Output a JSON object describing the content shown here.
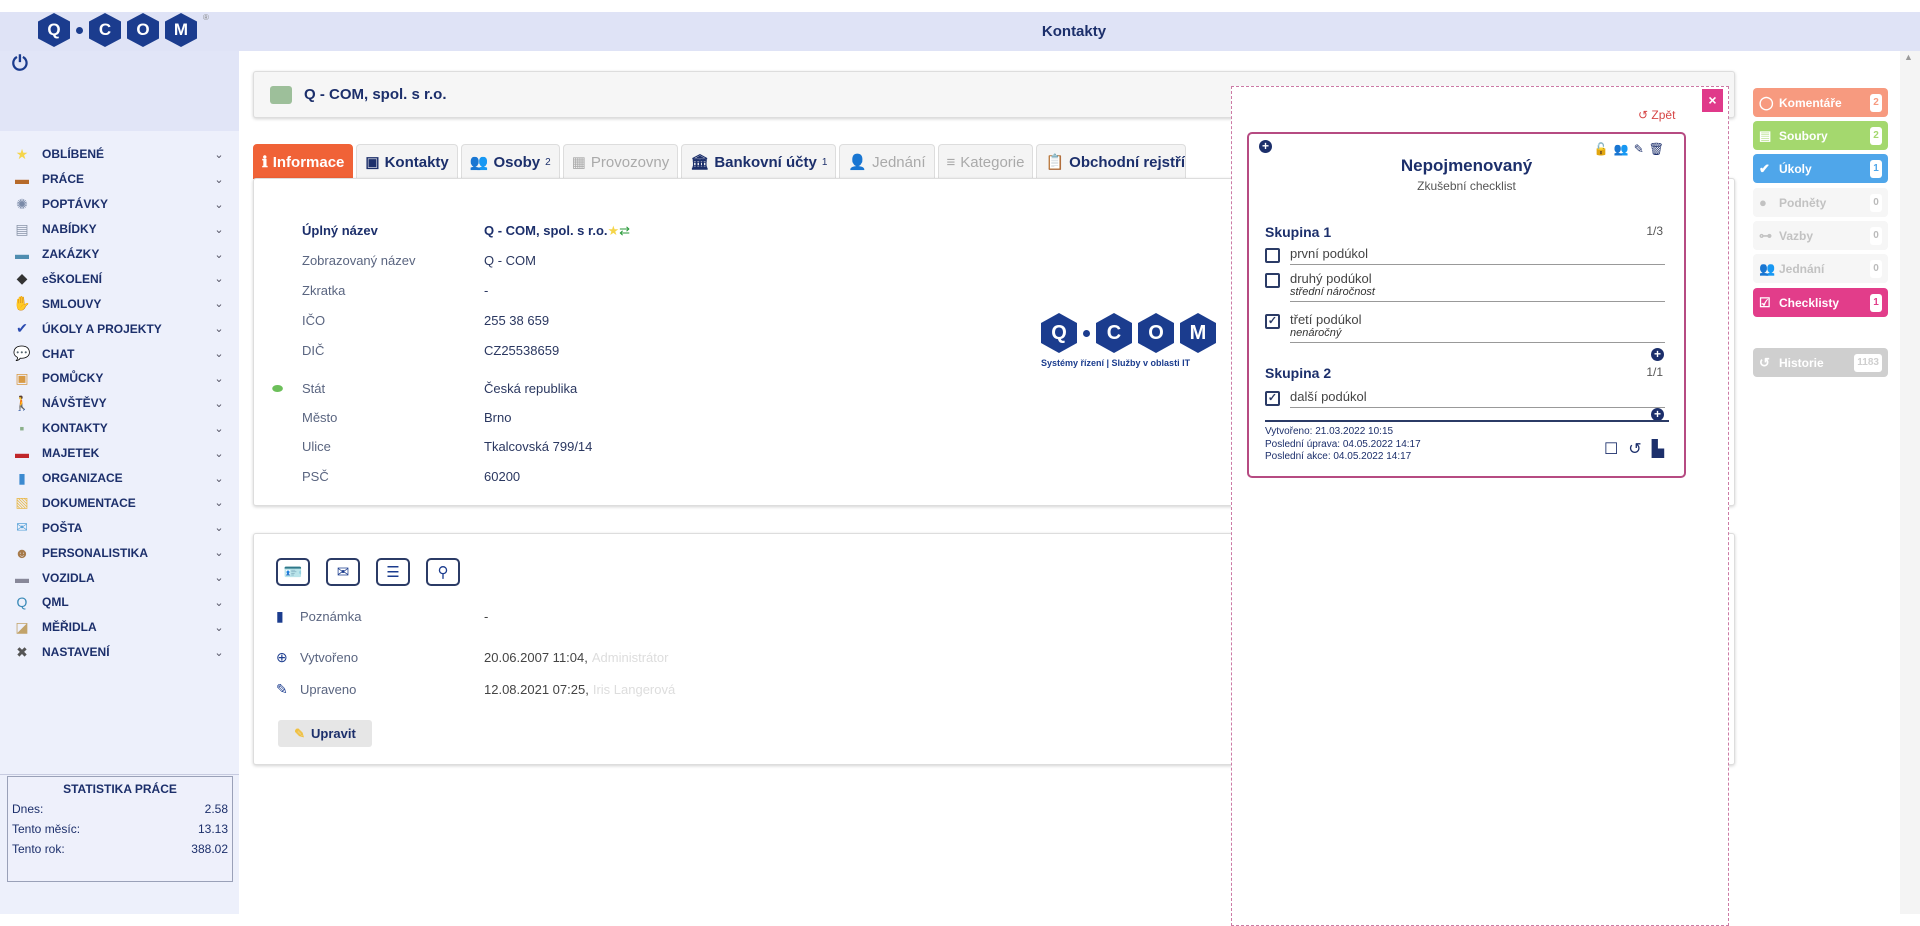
{
  "header": {
    "title": "Kontakty"
  },
  "logo": {
    "letters": [
      "Q",
      "C",
      "O",
      "M"
    ],
    "registered": "®"
  },
  "sidebar": {
    "items": [
      {
        "label": "OBLÍBENÉ",
        "icon": "star-icon",
        "glyph": "★",
        "color": "#f5d54a"
      },
      {
        "label": "PRÁCE",
        "icon": "briefcase-icon",
        "glyph": "▬",
        "color": "#b66a2a"
      },
      {
        "label": "POPTÁVKY",
        "icon": "lightbulb-icon",
        "glyph": "✺",
        "color": "#7a8aa8"
      },
      {
        "label": "NABÍDKY",
        "icon": "clipboard-icon",
        "glyph": "▤",
        "color": "#8a95a8"
      },
      {
        "label": "ZAKÁZKY",
        "icon": "case-icon",
        "glyph": "▬",
        "color": "#4f8db0"
      },
      {
        "label": "eŠKOLENÍ",
        "icon": "graduation-cap-icon",
        "glyph": "◆",
        "color": "#333"
      },
      {
        "label": "SMLOUVY",
        "icon": "handshake-icon",
        "glyph": "✋",
        "color": "#7a95b5"
      },
      {
        "label": "ÚKOLY A PROJEKTY",
        "icon": "task-icon",
        "glyph": "✔",
        "color": "#2b4bb0"
      },
      {
        "label": "CHAT",
        "icon": "chat-icon",
        "glyph": "💬",
        "color": "#46b5e8"
      },
      {
        "label": "POMŮCKY",
        "icon": "toolbox-icon",
        "glyph": "▣",
        "color": "#d89a45"
      },
      {
        "label": "NÁVŠTĚVY",
        "icon": "walking-icon",
        "glyph": "🚶",
        "color": "#1c3170"
      },
      {
        "label": "KONTAKTY",
        "icon": "contacts-icon",
        "glyph": "▪",
        "color": "#8bb08a"
      },
      {
        "label": "MAJETEK",
        "icon": "armchair-icon",
        "glyph": "▬",
        "color": "#c0262a"
      },
      {
        "label": "ORGANIZACE",
        "icon": "organization-icon",
        "glyph": "▮",
        "color": "#3c8ad0"
      },
      {
        "label": "DOKUMENTACE",
        "icon": "documents-icon",
        "glyph": "▧",
        "color": "#e8b84a"
      },
      {
        "label": "POŠTA",
        "icon": "mail-icon",
        "glyph": "✉",
        "color": "#5aa3d8"
      },
      {
        "label": "PERSONALISTIKA",
        "icon": "person-icon",
        "glyph": "☻",
        "color": "#a77a4a"
      },
      {
        "label": "VOZIDLA",
        "icon": "car-icon",
        "glyph": "▬",
        "color": "#889"
      },
      {
        "label": "QML",
        "icon": "qml-icon",
        "glyph": "Q",
        "color": "#3a8ab8"
      },
      {
        "label": "MĚŘIDLA",
        "icon": "ruler-icon",
        "glyph": "◪",
        "color": "#c2a36a"
      },
      {
        "label": "NASTAVENÍ",
        "icon": "tools-icon",
        "glyph": "✖",
        "color": "#555"
      }
    ]
  },
  "stats": {
    "title": "STATISTIKA PRÁCE",
    "rows": [
      {
        "label": "Dnes:",
        "value": "2.58"
      },
      {
        "label": "Tento měsíc:",
        "value": "13.13"
      },
      {
        "label": "Tento rok:",
        "value": "388.02"
      }
    ]
  },
  "contact": {
    "title": "Q - COM, spol. s r.o."
  },
  "tabs": [
    {
      "label": "Informace",
      "glyph": "ℹ",
      "count": ""
    },
    {
      "label": "Kontakty",
      "glyph": "▣",
      "count": ""
    },
    {
      "label": "Osoby",
      "glyph": "👥",
      "count": "2"
    },
    {
      "label": "Provozovny",
      "glyph": "▦",
      "count": ""
    },
    {
      "label": "Bankovní účty",
      "glyph": "🏛",
      "count": "1"
    },
    {
      "label": "Jednání",
      "glyph": "👤",
      "count": ""
    },
    {
      "label": "Kategorie",
      "glyph": "≡",
      "count": ""
    },
    {
      "label": "Obchodní rejstří",
      "glyph": "📋",
      "count": ""
    }
  ],
  "info": {
    "rows": [
      {
        "label": "Úplný název",
        "value": "Q - COM, spol. s r.o."
      },
      {
        "label": "Zobrazovaný název",
        "value": "Q - COM"
      },
      {
        "label": "Zkratka",
        "value": "-"
      },
      {
        "label": "IČO",
        "value": "255 38 659"
      },
      {
        "label": "DIČ",
        "value": "CZ25538659"
      },
      {
        "label": "Stát",
        "value": "Česká republika"
      },
      {
        "label": "Město",
        "value": "Brno"
      },
      {
        "label": "Ulice",
        "value": "Tkalcovská 799/14"
      },
      {
        "label": "PSČ",
        "value": "60200"
      }
    ],
    "slogan": "Systémy řízení  |  Služby v oblasti IT"
  },
  "meta": {
    "note_label": "Poznámka",
    "note_value": "-",
    "created_label": "Vytvořeno",
    "created_value": "20.06.2007 11:04,",
    "created_user": "Administrátor",
    "edited_label": "Upraveno",
    "edited_value": "12.08.2021 07:25,",
    "edited_user": "Iris Langerová",
    "edit_button": "Upravit"
  },
  "right_panel": [
    {
      "label": "Komentáře",
      "count": "2",
      "color": "#f79a7f",
      "glyph": "◯"
    },
    {
      "label": "Soubory",
      "count": "2",
      "color": "#a4d86e",
      "glyph": "▤"
    },
    {
      "label": "Úkoly",
      "count": "1",
      "color": "#4fa6ea",
      "glyph": "✔"
    },
    {
      "label": "Podněty",
      "count": "0",
      "color": "",
      "glyph": "●"
    },
    {
      "label": "Vazby",
      "count": "0",
      "color": "",
      "glyph": "⊶"
    },
    {
      "label": "Jednání",
      "count": "0",
      "color": "",
      "glyph": "👥"
    },
    {
      "label": "Checklisty",
      "count": "1",
      "color": "#e23d8a",
      "glyph": "☑"
    },
    {
      "label": "Historie",
      "count": "1183",
      "color": "#cfcfcf",
      "glyph": "↺"
    }
  ],
  "checklist": {
    "close": "×",
    "back": "Zpět",
    "title": "Nepojmenovaný",
    "subtitle": "Zkušební checklist",
    "groups": [
      {
        "name": "Skupina 1",
        "progress": "1/3",
        "items": [
          {
            "text": "první podúkol",
            "note": "",
            "checked": false
          },
          {
            "text": "druhý podúkol",
            "note": "střední náročnost",
            "checked": false
          },
          {
            "text": "třetí podúkol",
            "note": "nenáročný",
            "checked": true
          }
        ]
      },
      {
        "name": "Skupina 2",
        "progress": "1/1",
        "items": [
          {
            "text": "další podúkol",
            "note": "",
            "checked": true
          }
        ]
      }
    ],
    "created": "Vytvořeno: 21.03.2022 10:15",
    "last_edit": "Poslední úprava: 04.05.2022 14:17",
    "last_action": "Poslední akce: 04.05.2022 14:17"
  }
}
